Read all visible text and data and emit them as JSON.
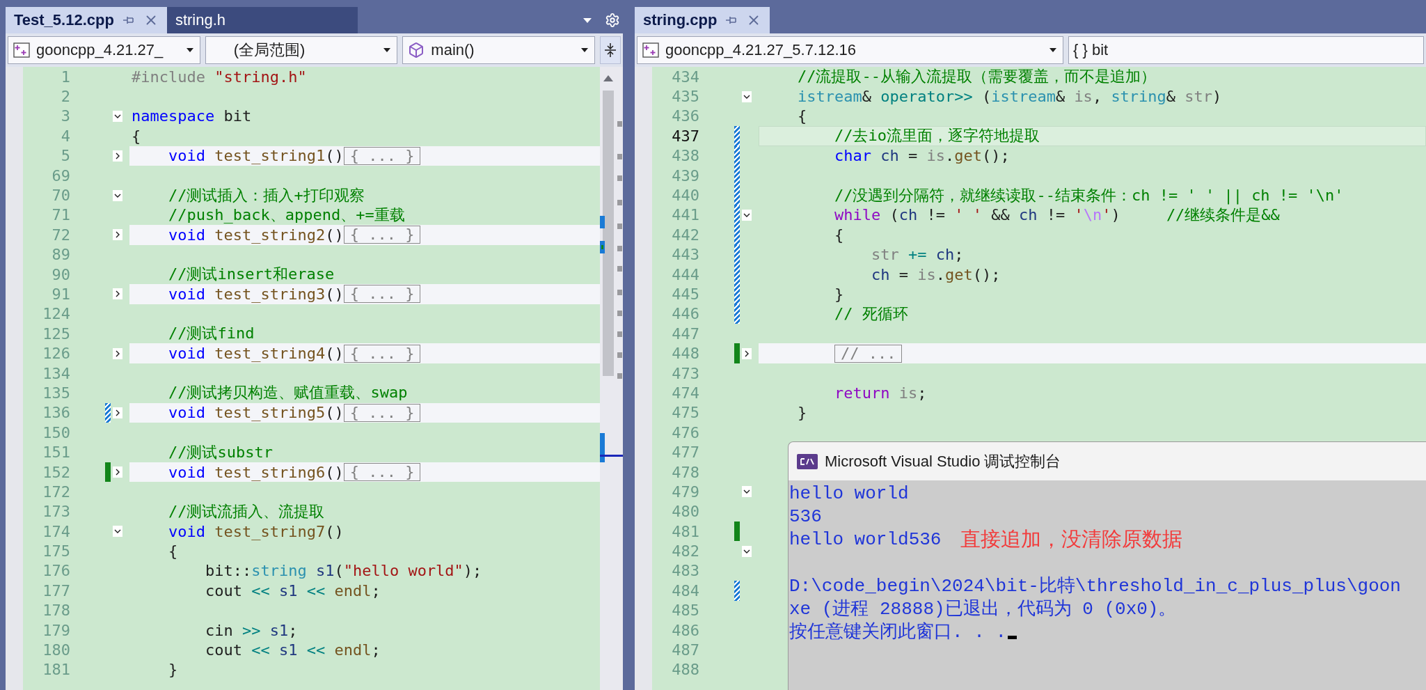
{
  "panes": [
    {
      "tabs": [
        {
          "label": "Test_5.12.cpp",
          "selected": true
        },
        {
          "label": "string.h",
          "selected": false
        }
      ],
      "tab_menu": true,
      "navbar": [
        {
          "kind": "project",
          "text": "gooncpp_4.21.27_"
        },
        {
          "kind": "scope",
          "text": "(全局范围)"
        },
        {
          "kind": "member",
          "text": "main()"
        }
      ],
      "split_button": true,
      "scrollbar": true,
      "lines": [
        {
          "n": "1",
          "code": [
            {
              "text": "#include ",
              "kind": "pp"
            },
            {
              "text": "\"string.h\"",
              "kind": "str"
            }
          ],
          "current": false
        },
        {
          "n": "2",
          "current": false
        },
        {
          "n": "3",
          "code": [
            {
              "text": "namespace",
              "kind": "kw"
            },
            {
              "text": " bit",
              "kind": "plain"
            }
          ],
          "expanded": true,
          "current": false
        },
        {
          "n": "4",
          "code": [
            {
              "text": "{",
              "kind": "plain"
            }
          ],
          "current": false
        },
        {
          "n": "5",
          "code": [
            {
              "text": "    void",
              "kind": "kw"
            },
            {
              "text": " test_string1",
              "kind": "fn"
            },
            {
              "text": "()",
              "kind": "plain"
            }
          ],
          "expanded": false,
          "collapsed": "{ ... }",
          "current": false
        },
        {
          "n": "69",
          "current": false
        },
        {
          "n": "70",
          "code": [
            {
              "text": "    //测试插入：插入+打印观察",
              "kind": "cm"
            }
          ],
          "expanded": true,
          "current": false
        },
        {
          "n": "71",
          "code": [
            {
              "text": "    //push_back、append、+=重载",
              "kind": "cm"
            }
          ],
          "current": false
        },
        {
          "n": "72",
          "code": [
            {
              "text": "    void",
              "kind": "kw"
            },
            {
              "text": " test_string2",
              "kind": "fn"
            },
            {
              "text": "()",
              "kind": "plain"
            }
          ],
          "expanded": false,
          "collapsed": "{ ... }",
          "current": false
        },
        {
          "n": "89",
          "current": false
        },
        {
          "n": "90",
          "code": [
            {
              "text": "    //测试insert和erase",
              "kind": "cm"
            }
          ],
          "current": false
        },
        {
          "n": "91",
          "code": [
            {
              "text": "    void",
              "kind": "kw"
            },
            {
              "text": " test_string3",
              "kind": "fn"
            },
            {
              "text": "()",
              "kind": "plain"
            }
          ],
          "expanded": false,
          "collapsed": "{ ... }",
          "current": false
        },
        {
          "n": "124",
          "current": false
        },
        {
          "n": "125",
          "code": [
            {
              "text": "    //测试find",
              "kind": "cm"
            }
          ],
          "current": false
        },
        {
          "n": "126",
          "code": [
            {
              "text": "    void",
              "kind": "kw"
            },
            {
              "text": " test_string4",
              "kind": "fn"
            },
            {
              "text": "()",
              "kind": "plain"
            }
          ],
          "expanded": false,
          "collapsed": "{ ... }",
          "current": false
        },
        {
          "n": "134",
          "current": false
        },
        {
          "n": "135",
          "code": [
            {
              "text": "    //测试拷贝构造、赋值重载、swap",
              "kind": "cm"
            }
          ],
          "current": false
        },
        {
          "n": "136",
          "code": [
            {
              "text": "    void",
              "kind": "kw"
            },
            {
              "text": " test_string5",
              "kind": "fn"
            },
            {
              "text": "()",
              "kind": "plain"
            }
          ],
          "expanded": false,
          "collapsed": "{ ... }",
          "saved": false,
          "current": false
        },
        {
          "n": "150",
          "current": false
        },
        {
          "n": "151",
          "code": [
            {
              "text": "    //测试substr",
              "kind": "cm"
            }
          ],
          "current": false
        },
        {
          "n": "152",
          "code": [
            {
              "text": "    void",
              "kind": "kw"
            },
            {
              "text": " test_string6",
              "kind": "fn"
            },
            {
              "text": "()",
              "kind": "plain"
            }
          ],
          "expanded": false,
          "collapsed": "{ ... }",
          "saved": true,
          "current": false
        },
        {
          "n": "172",
          "current": false
        },
        {
          "n": "173",
          "code": [
            {
              "text": "    //测试流插入、流提取",
              "kind": "cm"
            }
          ],
          "current": false
        },
        {
          "n": "174",
          "code": [
            {
              "text": "    void",
              "kind": "kw"
            },
            {
              "text": " test_string7",
              "kind": "fn"
            },
            {
              "text": "()",
              "kind": "plain"
            }
          ],
          "expanded": true,
          "current": false
        },
        {
          "n": "175",
          "code": [
            {
              "text": "    {",
              "kind": "plain"
            }
          ],
          "current": false
        },
        {
          "n": "176",
          "code": [
            {
              "text": "        bit::",
              "kind": "plain"
            },
            {
              "text": "string",
              "kind": "type"
            },
            {
              "text": " s1",
              "kind": "var"
            },
            {
              "text": "(",
              "kind": "plain"
            },
            {
              "text": "\"hello world\"",
              "kind": "str"
            },
            {
              "text": ");",
              "kind": "plain"
            }
          ],
          "current": false
        },
        {
          "n": "177",
          "code": [
            {
              "text": "        cout",
              "kind": "plain"
            },
            {
              "text": " <<",
              "kind": "op"
            },
            {
              "text": " s1",
              "kind": "var"
            },
            {
              "text": " <<",
              "kind": "op"
            },
            {
              "text": " endl",
              "kind": "fn"
            },
            {
              "text": ";",
              "kind": "plain"
            }
          ],
          "current": false
        },
        {
          "n": "178",
          "current": false
        },
        {
          "n": "179",
          "code": [
            {
              "text": "        cin",
              "kind": "plain"
            },
            {
              "text": " >>",
              "kind": "op"
            },
            {
              "text": " s1",
              "kind": "var"
            },
            {
              "text": ";",
              "kind": "plain"
            }
          ],
          "current": false
        },
        {
          "n": "180",
          "code": [
            {
              "text": "        cout",
              "kind": "plain"
            },
            {
              "text": " <<",
              "kind": "op"
            },
            {
              "text": " s1",
              "kind": "var"
            },
            {
              "text": " <<",
              "kind": "op"
            },
            {
              "text": " endl",
              "kind": "fn"
            },
            {
              "text": ";",
              "kind": "plain"
            }
          ],
          "current": false
        },
        {
          "n": "181",
          "code": [
            {
              "text": "    }",
              "kind": "plain"
            }
          ],
          "current": false
        }
      ]
    },
    {
      "tabs": [
        {
          "label": "string.cpp",
          "selected": true
        }
      ],
      "navbar": [
        {
          "kind": "project",
          "text": "gooncpp_4.21.27_5.7.12.16"
        },
        {
          "kind": "namespace",
          "text": "{ } bit"
        }
      ],
      "lines": [
        {
          "n": "434",
          "code": [
            {
              "text": "    //流提取--从输入流提取（需要覆盖，而不是追加）",
              "kind": "cm"
            }
          ],
          "current": false
        },
        {
          "n": "435",
          "code": [
            {
              "text": "    istream",
              "kind": "type"
            },
            {
              "text": "&",
              "kind": "plain"
            },
            {
              "text": " operator>>",
              "kind": "op"
            },
            {
              "text": " (",
              "kind": "plain"
            },
            {
              "text": "istream",
              "kind": "type"
            },
            {
              "text": "& ",
              "kind": "plain"
            },
            {
              "text": "is",
              "kind": "param"
            },
            {
              "text": ", ",
              "kind": "plain"
            },
            {
              "text": "string",
              "kind": "type"
            },
            {
              "text": "& ",
              "kind": "plain"
            },
            {
              "text": "str",
              "kind": "param"
            },
            {
              "text": ")",
              "kind": "plain"
            }
          ],
          "expanded": true,
          "current": false
        },
        {
          "n": "436",
          "code": [
            {
              "text": "    {",
              "kind": "plain"
            }
          ],
          "current": false
        },
        {
          "n": "437",
          "code": [
            {
              "text": "        //去io流里面，逐字符地提取",
              "kind": "cm"
            }
          ],
          "saved": false,
          "current": true
        },
        {
          "n": "438",
          "code": [
            {
              "text": "        char",
              "kind": "kw"
            },
            {
              "text": " ch",
              "kind": "var"
            },
            {
              "text": " = ",
              "kind": "plain"
            },
            {
              "text": "is",
              "kind": "param"
            },
            {
              "text": ".",
              "kind": "plain"
            },
            {
              "text": "get",
              "kind": "fn"
            },
            {
              "text": "();",
              "kind": "plain"
            }
          ],
          "saved": false,
          "current": false
        },
        {
          "n": "439",
          "saved": false,
          "current": false
        },
        {
          "n": "440",
          "code": [
            {
              "text": "        //没遇到分隔符，就继续读取--结束条件：ch != ' ' || ch != '\\n'",
              "kind": "cm"
            }
          ],
          "saved": false,
          "current": false
        },
        {
          "n": "441",
          "code": [
            {
              "text": "        while",
              "kind": "ctrl"
            },
            {
              "text": " (",
              "kind": "plain"
            },
            {
              "text": "ch",
              "kind": "var"
            },
            {
              "text": " != ",
              "kind": "plain"
            },
            {
              "text": "' '",
              "kind": "str"
            },
            {
              "text": " && ",
              "kind": "plain"
            },
            {
              "text": "ch",
              "kind": "var"
            },
            {
              "text": " != ",
              "kind": "plain"
            },
            {
              "text": "'",
              "kind": "str"
            },
            {
              "text": "\\n",
              "kind": "esc"
            },
            {
              "text": "'",
              "kind": "str"
            },
            {
              "text": ")     ",
              "kind": "plain"
            },
            {
              "text": "//继续条件是&&",
              "kind": "cm"
            }
          ],
          "expanded": true,
          "saved": false,
          "current": false
        },
        {
          "n": "442",
          "code": [
            {
              "text": "        {",
              "kind": "plain"
            }
          ],
          "saved": false,
          "current": false
        },
        {
          "n": "443",
          "code": [
            {
              "text": "            str",
              "kind": "param"
            },
            {
              "text": " +=",
              "kind": "op"
            },
            {
              "text": " ch",
              "kind": "var"
            },
            {
              "text": ";",
              "kind": "plain"
            }
          ],
          "saved": false,
          "current": false
        },
        {
          "n": "444",
          "code": [
            {
              "text": "            ch",
              "kind": "var"
            },
            {
              "text": " = ",
              "kind": "plain"
            },
            {
              "text": "is",
              "kind": "param"
            },
            {
              "text": ".",
              "kind": "plain"
            },
            {
              "text": "get",
              "kind": "fn"
            },
            {
              "text": "();",
              "kind": "plain"
            }
          ],
          "saved": false,
          "current": false
        },
        {
          "n": "445",
          "code": [
            {
              "text": "        }",
              "kind": "plain"
            }
          ],
          "saved": false,
          "current": false
        },
        {
          "n": "446",
          "code": [
            {
              "text": "        // 死循环",
              "kind": "cm"
            }
          ],
          "saved": false,
          "current": false
        },
        {
          "n": "447",
          "current": false
        },
        {
          "n": "448",
          "expanded": false,
          "collapsed": "        // ...",
          "saved": true,
          "current": false
        },
        {
          "n": "473",
          "current": false
        },
        {
          "n": "474",
          "code": [
            {
              "text": "        return",
              "kind": "ctrl"
            },
            {
              "text": " is",
              "kind": "param"
            },
            {
              "text": ";",
              "kind": "plain"
            }
          ],
          "current": false
        },
        {
          "n": "475",
          "code": [
            {
              "text": "    }",
              "kind": "plain"
            }
          ],
          "current": false
        },
        {
          "n": "476",
          "current": false
        },
        {
          "n": "477",
          "current": false
        },
        {
          "n": "478",
          "current": false
        },
        {
          "n": "479",
          "expanded": true,
          "current": false
        },
        {
          "n": "480",
          "current": false
        },
        {
          "n": "481",
          "saved": true,
          "current": false
        },
        {
          "n": "482",
          "expanded": true,
          "current": false
        },
        {
          "n": "483",
          "current": false
        },
        {
          "n": "484",
          "saved": false,
          "current": false
        },
        {
          "n": "485",
          "current": false
        },
        {
          "n": "486",
          "current": false
        },
        {
          "n": "487",
          "current": false
        },
        {
          "n": "488",
          "current": false
        }
      ]
    }
  ],
  "console": {
    "title": "Microsoft Visual Studio 调试控制台",
    "cursor": true,
    "lines": [
      {
        "text": "hello world"
      },
      {
        "text": "536"
      },
      {
        "text": "hello world536",
        "note": "直接追加，没清除原数据"
      },
      {
        "text": "D:\\code_begin\\2024\\bit-比特\\threshold_in_c_plus_plus\\goon",
        "blank_before": true
      },
      {
        "text": "xe (进程 28888)已退出，代码为 0 (0x0)。"
      },
      {
        "text": "按任意键关闭此窗口. . ."
      }
    ]
  }
}
